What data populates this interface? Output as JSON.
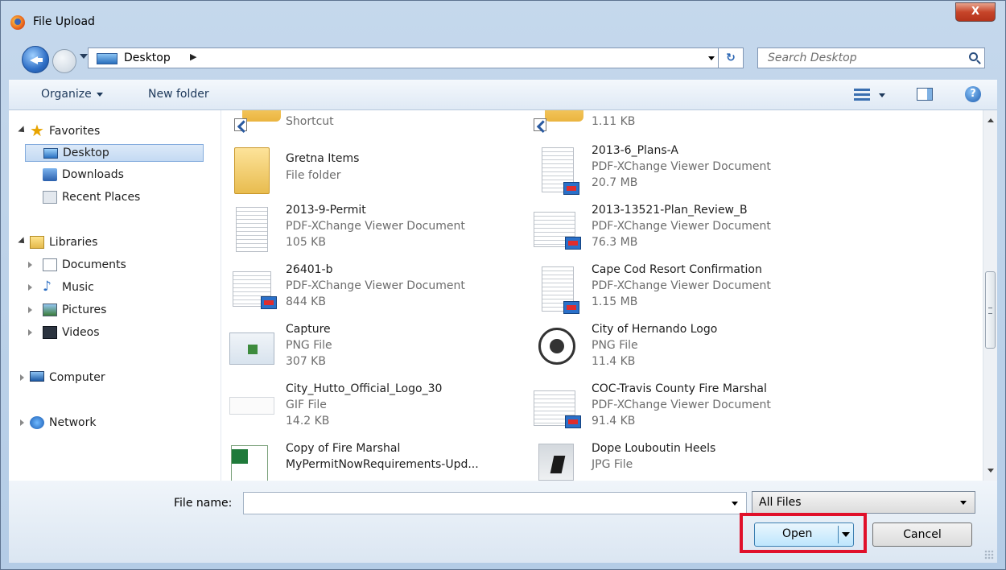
{
  "window": {
    "title": "File Upload",
    "close_label": "X"
  },
  "address_bar": {
    "location": "Desktop",
    "separator": "▶",
    "refresh_symbol": "↻"
  },
  "search": {
    "placeholder": "Search Desktop"
  },
  "toolbar": {
    "organize_label": "Organize",
    "new_folder_label": "New folder",
    "help_symbol": "?"
  },
  "nav": {
    "favorites_label": "Favorites",
    "desktop_label": "Desktop",
    "downloads_label": "Downloads",
    "recent_places_label": "Recent Places",
    "libraries_label": "Libraries",
    "documents_label": "Documents",
    "music_label": "Music",
    "pictures_label": "Pictures",
    "videos_label": "Videos",
    "computer_label": "Computer",
    "network_label": "Network"
  },
  "files": {
    "partial_left": {
      "type": "Shortcut"
    },
    "partial_right": {
      "size": "1.11 KB"
    },
    "items": [
      {
        "name": "Gretna Items",
        "type": "File folder",
        "size": ""
      },
      {
        "name": "2013-6_Plans-A",
        "type": "PDF-XChange Viewer Document",
        "size": "20.7 MB"
      },
      {
        "name": "2013-9-Permit",
        "type": "PDF-XChange Viewer Document",
        "size": "105 KB"
      },
      {
        "name": "2013-13521-Plan_Review_B",
        "type": "PDF-XChange Viewer Document",
        "size": "76.3 MB"
      },
      {
        "name": "26401-b",
        "type": "PDF-XChange Viewer Document",
        "size": "844 KB"
      },
      {
        "name": "Cape Cod Resort Confirmation",
        "type": "PDF-XChange Viewer Document",
        "size": "1.15 MB"
      },
      {
        "name": "Capture",
        "type": "PNG File",
        "size": "307 KB"
      },
      {
        "name": "City of Hernando Logo",
        "type": "PNG File",
        "size": "11.4 KB"
      },
      {
        "name": "City_Hutto_Official_Logo_30",
        "type": "GIF File",
        "size": "14.2 KB"
      },
      {
        "name": "COC-Travis County Fire Marshal",
        "type": "PDF-XChange Viewer Document",
        "size": "91.4 KB"
      },
      {
        "name": "Copy of Fire Marshal",
        "type": "MyPermitNowRequirements-Upd...",
        "size": ""
      },
      {
        "name": "Dope Louboutin Heels",
        "type": "JPG File",
        "size": ""
      }
    ]
  },
  "bottom": {
    "file_name_label": "File name:",
    "file_name_value": "",
    "file_type_value": "All Files",
    "open_label": "Open",
    "cancel_label": "Cancel"
  },
  "colors": {
    "highlight": "#e0102a",
    "accent": "#2a6fbd"
  }
}
